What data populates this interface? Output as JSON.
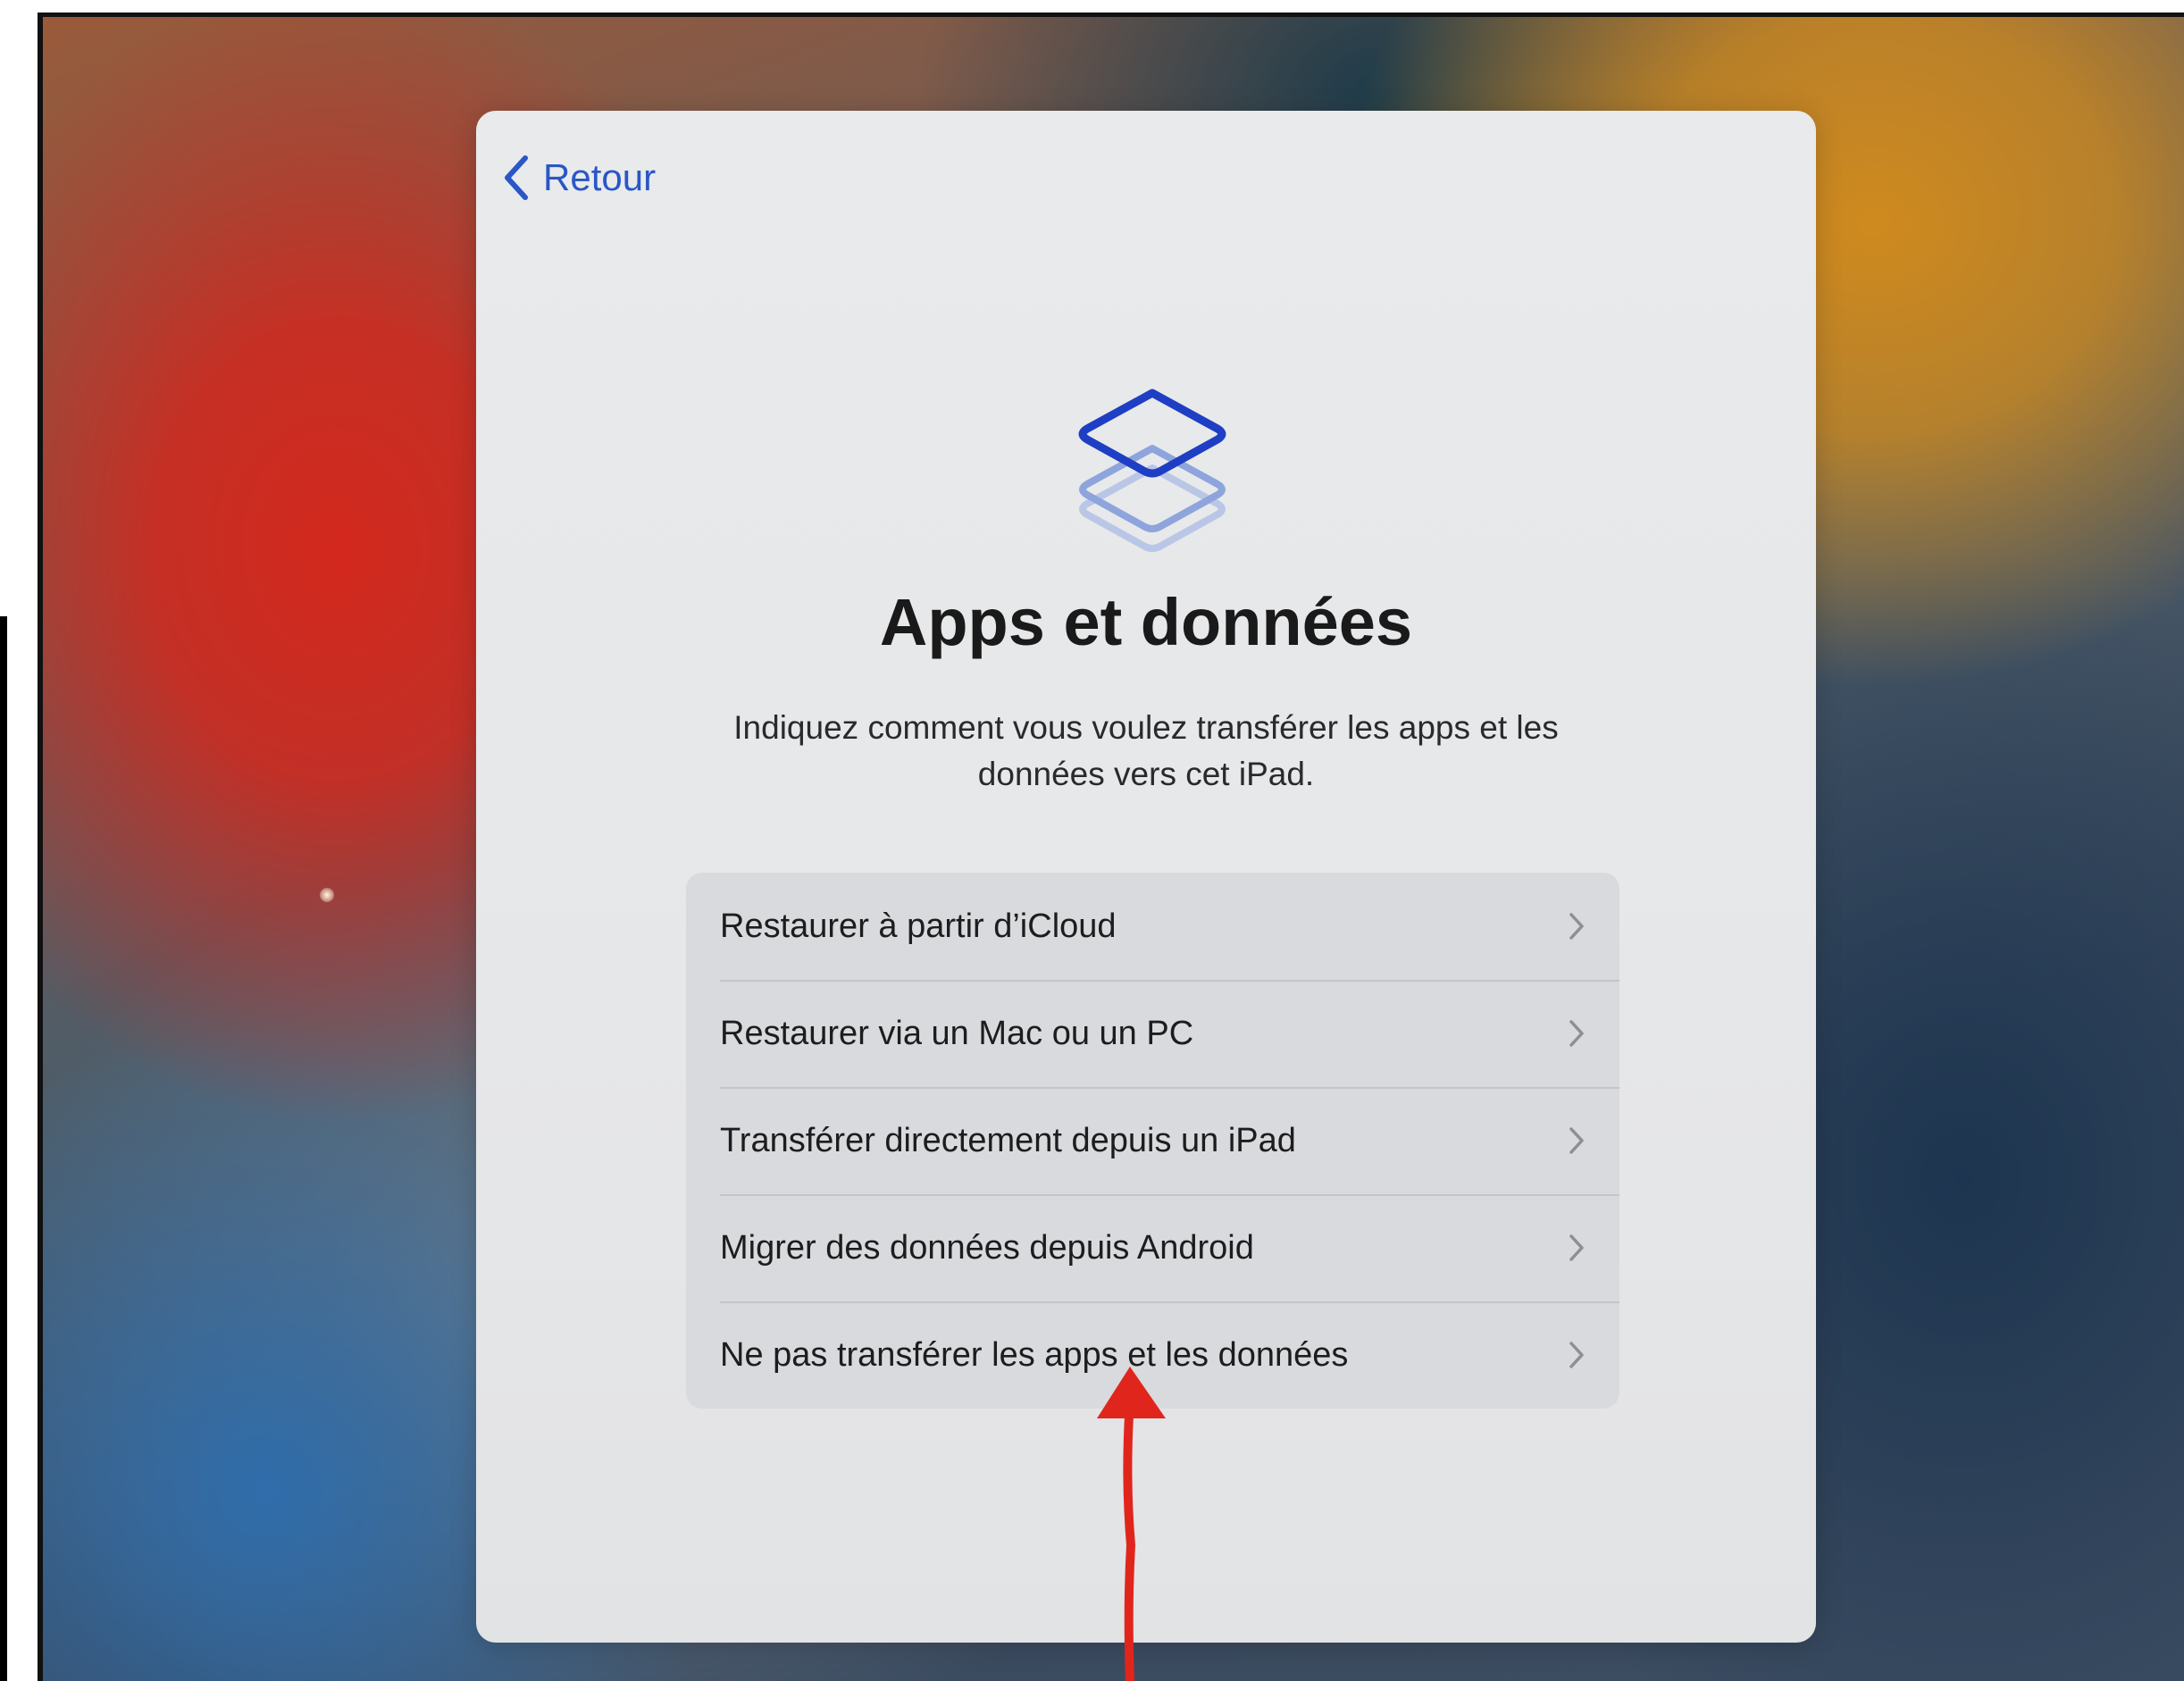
{
  "nav": {
    "back_label": "Retour"
  },
  "page": {
    "title": "Apps et données",
    "subtitle": "Indiquez comment vous voulez transférer les apps et les données vers cet iPad."
  },
  "options": [
    {
      "label": "Restaurer à partir d’iCloud"
    },
    {
      "label": "Restaurer via un Mac ou un PC"
    },
    {
      "label": "Transférer directement depuis un iPad"
    },
    {
      "label": "Migrer des données depuis Android"
    },
    {
      "label": "Ne pas transférer les apps et les données"
    }
  ],
  "icons": {
    "back": "chevron-left-icon",
    "header": "stacked-layers-icon",
    "row": "chevron-right-icon",
    "annotation": "red-arrow-up"
  },
  "colors": {
    "accent": "#2a56c6",
    "annotation": "#e0261c"
  }
}
